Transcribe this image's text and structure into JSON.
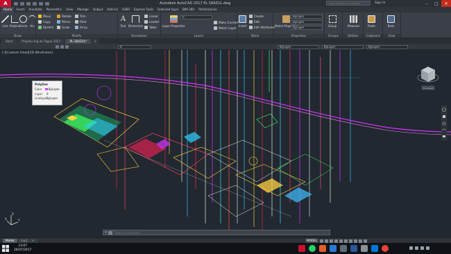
{
  "titlebar": {
    "app_button": "A",
    "title": "Autodesk AutoCAD 2017   PL-18AZUL.dwg",
    "search_placeholder": "Type a keyword or phrase",
    "sign_in": "Sign In",
    "minimize": "–",
    "maximize": "□",
    "close": "✕"
  },
  "ribbon_tabs": [
    "Home",
    "Insert",
    "Annotate",
    "Parametric",
    "View",
    "Manage",
    "Output",
    "Add-ins",
    "A360",
    "Express Tools",
    "Featured Apps",
    "BIM 360",
    "Performance"
  ],
  "ribbon": {
    "draw": {
      "label": "Draw",
      "tools": [
        "Line",
        "Polyline",
        "Circle",
        "Arc"
      ]
    },
    "modify": {
      "label": "Modify",
      "tools": [
        "Move",
        "Rotate",
        "Trim",
        "Copy",
        "Mirror",
        "Fillet",
        "Stretch",
        "Scale",
        "Array"
      ]
    },
    "annotation": {
      "label": "Annotation",
      "text": "Text",
      "dimension": "Dimension",
      "tools": [
        "Linear",
        "Leader",
        "Table"
      ]
    },
    "layers": {
      "label": "Layers",
      "layer_properties": "Layer Properties",
      "current_layer": "0",
      "tools": [
        "Make Current",
        "Match Layer"
      ]
    },
    "block": {
      "label": "Block",
      "insert": "Insert",
      "tools": [
        "Create",
        "Edit",
        "Edit Attributes"
      ]
    },
    "properties": {
      "label": "Properties",
      "match": "Match Properties",
      "color": "ByLayer",
      "linetype": "ByLayer",
      "lineweight": "ByLayer"
    },
    "groups": {
      "label": "Groups",
      "tool": "Group"
    },
    "utilities": {
      "label": "Utilities",
      "tool": "Measure"
    },
    "clipboard": {
      "label": "Clipboard",
      "tool": "Paste"
    },
    "view": {
      "label": "View",
      "tool": "Base"
    }
  },
  "file_tabs": [
    "Start",
    "Projeto ring de Tagoa 2017",
    "PL-18AZUL*",
    "+"
  ],
  "prop_toolbar": {
    "layer": "0",
    "color": "ByLayer",
    "linetype": "ByLayer",
    "lineweight": "ByLayer"
  },
  "viewport": {
    "label": "[-][Custom View][2D Wireframe]",
    "viewcube_label": "Unnamed"
  },
  "tooltip": {
    "title": "Polyline",
    "rows": [
      {
        "key": "Color",
        "value": "ByLayer"
      },
      {
        "key": "Layer",
        "value": "0"
      },
      {
        "key": "Linetype",
        "value": "ByLayer"
      }
    ]
  },
  "command_line": {
    "placeholder": "Type a command"
  },
  "layout_tabs": [
    "Model",
    "Lay1",
    "+"
  ],
  "status": {
    "model": "MODEL"
  },
  "taskbar": {
    "time": "13:07",
    "date": "26/07/2017"
  },
  "colors": {
    "accent": "#c8102e",
    "background": "#212830",
    "polyline_magenta": "#d634ff"
  }
}
